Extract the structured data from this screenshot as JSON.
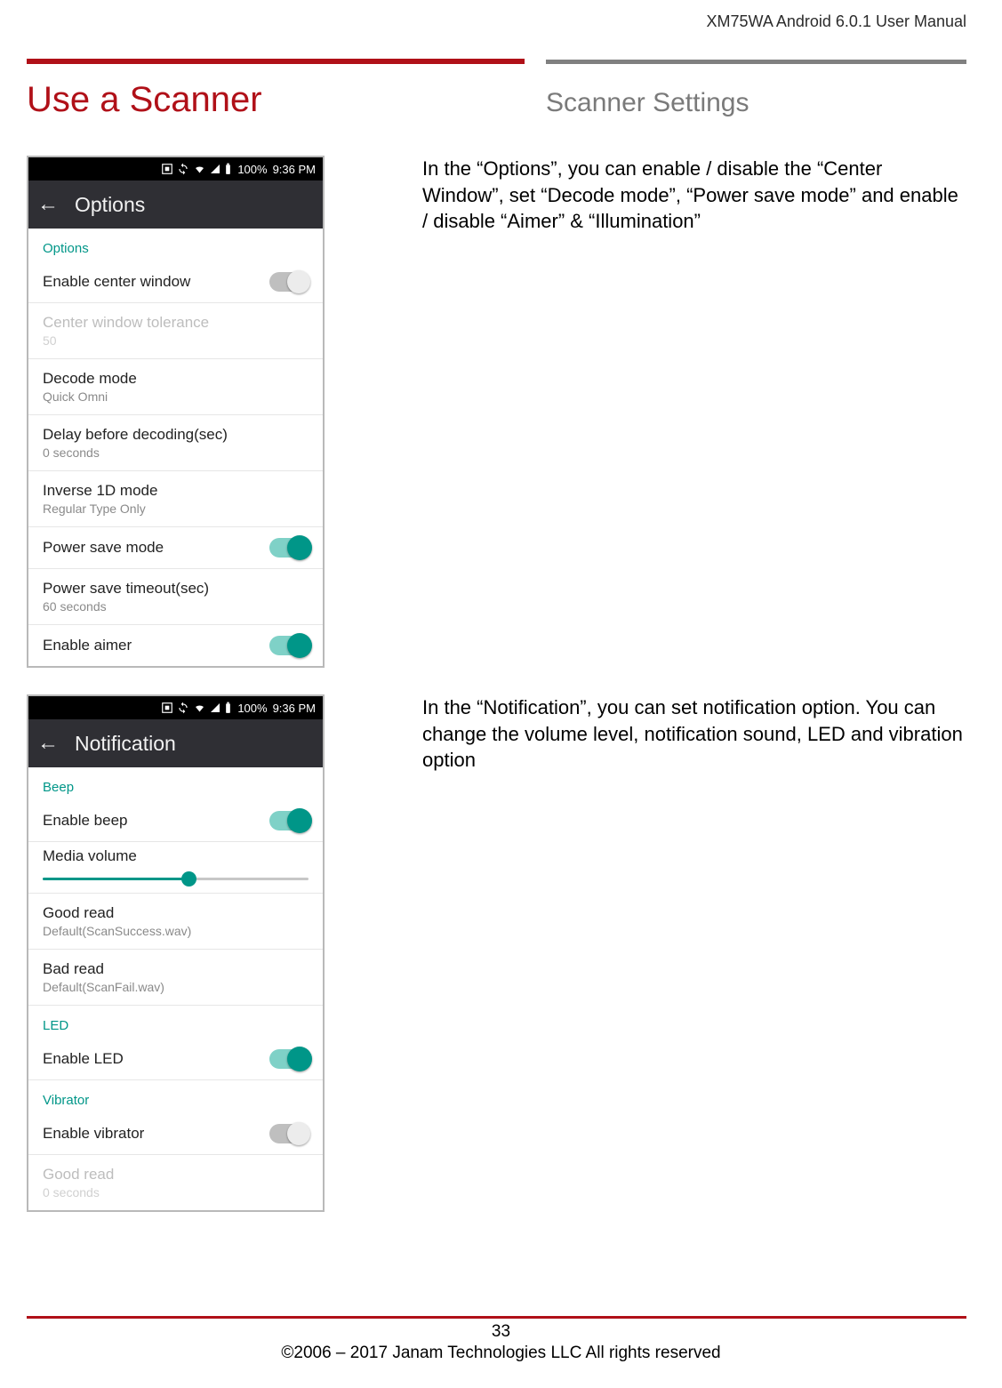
{
  "header_right": "XM75WA Android 6.0.1 User Manual",
  "title_left": "Use a Scanner",
  "title_right": "Scanner Settings",
  "status": {
    "battery": "100%",
    "time": "9:36 PM"
  },
  "options_screen": {
    "appbar_title": "Options",
    "section": "Options",
    "rows": [
      {
        "primary": "Enable center window",
        "switch": "off"
      },
      {
        "primary": "Center window tolerance",
        "secondary": "50",
        "disabled": true
      },
      {
        "primary": "Decode mode",
        "secondary": "Quick Omni"
      },
      {
        "primary": "Delay before decoding(sec)",
        "secondary": "0 seconds"
      },
      {
        "primary": "Inverse 1D mode",
        "secondary": "Regular Type Only"
      },
      {
        "primary": "Power save mode",
        "switch": "on"
      },
      {
        "primary": "Power save timeout(sec)",
        "secondary": "60 seconds"
      },
      {
        "primary": "Enable aimer",
        "switch": "on"
      }
    ]
  },
  "notification_screen": {
    "appbar_title": "Notification",
    "sections": {
      "beep": "Beep",
      "led": "LED",
      "vibrator": "Vibrator"
    },
    "enable_beep": "Enable beep",
    "media_volume": "Media volume",
    "volume_pct": 55,
    "good_read": {
      "primary": "Good read",
      "secondary": "Default(ScanSuccess.wav)"
    },
    "bad_read": {
      "primary": "Bad read",
      "secondary": "Default(ScanFail.wav)"
    },
    "enable_led": "Enable LED",
    "enable_vibrator": "Enable vibrator",
    "good_read_vib": {
      "primary": "Good read",
      "secondary": "0 seconds"
    }
  },
  "para1": "In the “Options”, you can enable / disable the “Center Window”, set “Decode mode”, “Power save mode” and enable / disable “Aimer” & “Illumination”",
  "para2": "In the “Notification”, you can set notification option. You can change the volume level, notification sound, LED and vibration option",
  "footer": {
    "page": "33",
    "copyright": "©2006 – 2017 Janam Technologies LLC All rights reserved"
  }
}
